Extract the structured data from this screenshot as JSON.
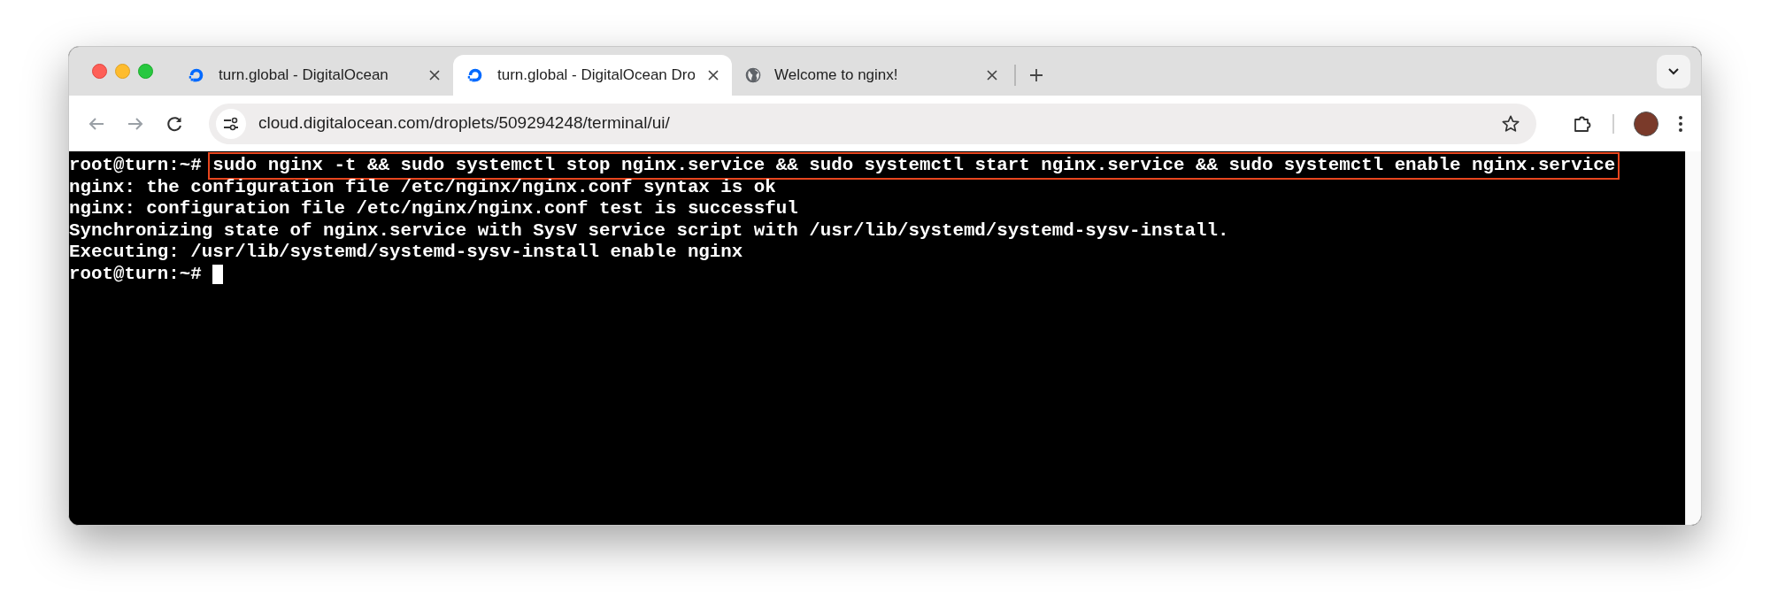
{
  "tabs": [
    {
      "title": "turn.global - DigitalOcean",
      "selected": false,
      "kind": "droplet"
    },
    {
      "title": "turn.global - DigitalOcean Dro",
      "selected": true,
      "kind": "droplet"
    },
    {
      "title": "Welcome to nginx!",
      "selected": false,
      "kind": "globe"
    }
  ],
  "address": {
    "url": "cloud.digitalocean.com/droplets/509294248/terminal/ui/"
  },
  "terminal": {
    "lines": [
      {
        "kind": "command",
        "prompt": "root@turn:~#",
        "text": "sudo nginx -t && sudo systemctl stop nginx.service && sudo systemctl start nginx.service && sudo systemctl enable nginx.service",
        "highlighted": true
      },
      {
        "kind": "output",
        "text": "nginx: the configuration file /etc/nginx/nginx.conf syntax is ok"
      },
      {
        "kind": "output",
        "text": "nginx: configuration file /etc/nginx/nginx.conf test is successful"
      },
      {
        "kind": "output",
        "text": "Synchronizing state of nginx.service with SysV service script with /usr/lib/systemd/systemd-sysv-install."
      },
      {
        "kind": "output",
        "text": "Executing: /usr/lib/systemd/systemd-sysv-install enable nginx"
      },
      {
        "kind": "prompt",
        "prompt": "root@turn:~#",
        "cursor": true
      }
    ]
  }
}
